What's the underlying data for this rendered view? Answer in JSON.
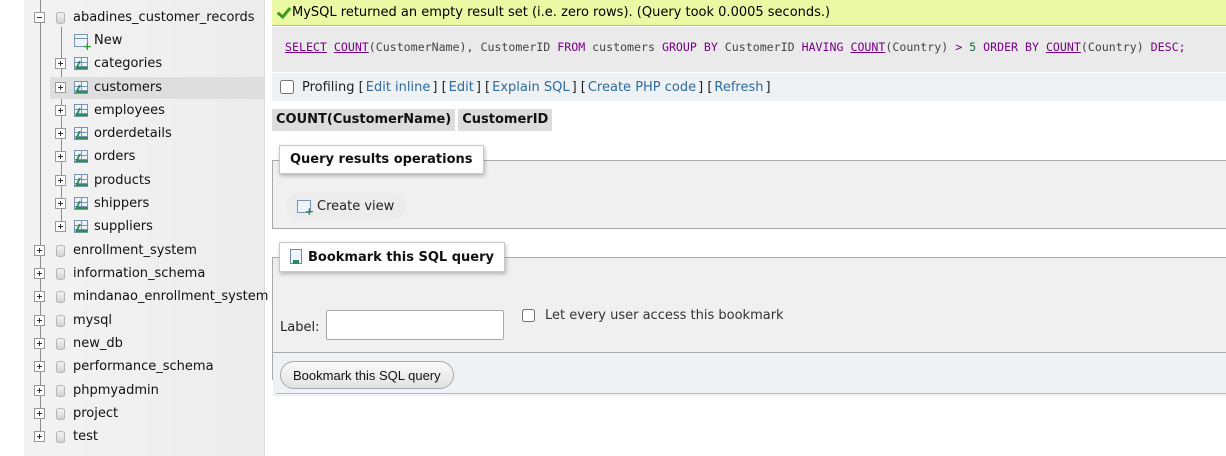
{
  "nav": {
    "current_db": "abadines_customer_records",
    "new_label": "New",
    "tables": [
      {
        "name": "categories"
      },
      {
        "name": "customers"
      },
      {
        "name": "employees"
      },
      {
        "name": "orderdetails"
      },
      {
        "name": "orders"
      },
      {
        "name": "products"
      },
      {
        "name": "shippers"
      },
      {
        "name": "suppliers"
      }
    ],
    "other_dbs": [
      {
        "name": "enrollment_system"
      },
      {
        "name": "information_schema"
      },
      {
        "name": "mindanao_enrollment_system"
      },
      {
        "name": "mysql"
      },
      {
        "name": "new_db"
      },
      {
        "name": "performance_schema"
      },
      {
        "name": "phpmyadmin"
      },
      {
        "name": "project"
      },
      {
        "name": "test"
      }
    ]
  },
  "message": {
    "text": "MySQL returned an empty result set (i.e. zero rows). (Query took 0.0005 seconds.)"
  },
  "sql": {
    "select": "SELECT",
    "count1": "COUNT",
    "part1": "(CustomerName), CustomerID",
    "from": "FROM",
    "part2": "customers",
    "group_by": "GROUP BY",
    "part3": "CustomerID",
    "having": "HAVING",
    "count2": "COUNT",
    "part4": "(Country)",
    "gt": ">",
    "five": "5",
    "order_by": "ORDER BY",
    "count3": "COUNT",
    "part5": "(Country)",
    "desc": "DESC;"
  },
  "toolbar": {
    "profiling": "Profiling",
    "edit_inline": "Edit inline",
    "edit": "Edit",
    "explain": "Explain SQL",
    "php": "Create PHP code",
    "refresh": "Refresh"
  },
  "results": {
    "columns": [
      "COUNT(CustomerName)",
      "CustomerID"
    ]
  },
  "operations": {
    "legend": "Query results operations",
    "create_view": "Create view"
  },
  "bookmark": {
    "legend": "Bookmark this SQL query",
    "label": "Label:",
    "access": "Let every user access this bookmark",
    "button": "Bookmark this SQL query"
  },
  "colors": {
    "success_bg": "#ebf8a4",
    "link": "#2f6a9a",
    "keyword": "#770088"
  }
}
